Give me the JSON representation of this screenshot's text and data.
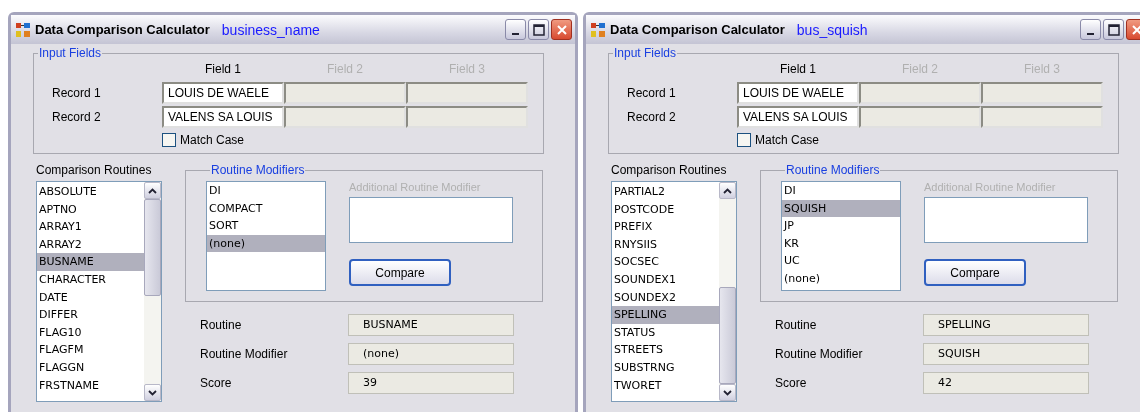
{
  "windows": [
    {
      "title": "Data Comparison Calculator",
      "subtitle": "business_name",
      "input_fields": {
        "title": "Input Fields",
        "columns": [
          {
            "label": "Field 1",
            "disabled": false
          },
          {
            "label": "Field 2",
            "disabled": true
          },
          {
            "label": "Field 3",
            "disabled": true
          }
        ],
        "records": [
          {
            "label": "Record 1",
            "value": "LOUIS DE WAELE"
          },
          {
            "label": "Record 2",
            "value": "VALENS SA LOUIS"
          }
        ],
        "match_case": {
          "label": "Match Case",
          "checked": false
        }
      },
      "routines": {
        "label": "Comparison Routines",
        "items": [
          {
            "label": "ABSOLUTE",
            "selected": false
          },
          {
            "label": "APTNO",
            "selected": false
          },
          {
            "label": "ARRAY1",
            "selected": false
          },
          {
            "label": "ARRAY2",
            "selected": false
          },
          {
            "label": "BUSNAME",
            "selected": true
          },
          {
            "label": "CHARACTER",
            "selected": false
          },
          {
            "label": "DATE",
            "selected": false
          },
          {
            "label": "DIFFER",
            "selected": false
          },
          {
            "label": "FLAG10",
            "selected": false
          },
          {
            "label": "FLAGFM",
            "selected": false
          },
          {
            "label": "FLAGGN",
            "selected": false
          },
          {
            "label": "FRSTNAME",
            "selected": false
          }
        ]
      },
      "modifiers": {
        "title": "Routine Modifiers",
        "items": [
          {
            "label": "DI",
            "selected": false
          },
          {
            "label": "COMPACT",
            "selected": false
          },
          {
            "label": "SORT",
            "selected": false
          },
          {
            "label": "(none)",
            "selected": true
          }
        ],
        "additional": {
          "label": "Additional Routine Modifier",
          "disabled": true
        },
        "button": "Compare"
      },
      "results": [
        {
          "label": "Routine",
          "value": "BUSNAME"
        },
        {
          "label": "Routine Modifier",
          "value": "(none)"
        },
        {
          "label": "Score",
          "value": "39"
        }
      ]
    },
    {
      "title": "Data Comparison Calculator",
      "subtitle": "bus_squish",
      "input_fields": {
        "title": "Input Fields",
        "columns": [
          {
            "label": "Field 1",
            "disabled": false
          },
          {
            "label": "Field 2",
            "disabled": true
          },
          {
            "label": "Field 3",
            "disabled": true
          }
        ],
        "records": [
          {
            "label": "Record 1",
            "value": "LOUIS DE WAELE"
          },
          {
            "label": "Record 2",
            "value": "VALENS SA LOUIS"
          }
        ],
        "match_case": {
          "label": "Match Case",
          "checked": false
        }
      },
      "routines": {
        "label": "Comparison Routines",
        "items": [
          {
            "label": "PARTIAL2",
            "selected": false
          },
          {
            "label": "POSTCODE",
            "selected": false
          },
          {
            "label": "PREFIX",
            "selected": false
          },
          {
            "label": "RNYSIIS",
            "selected": false
          },
          {
            "label": "SOCSEC",
            "selected": false
          },
          {
            "label": "SOUNDEX1",
            "selected": false
          },
          {
            "label": "SOUNDEX2",
            "selected": false
          },
          {
            "label": "SPELLING",
            "selected": true
          },
          {
            "label": "STATUS",
            "selected": false
          },
          {
            "label": "STREETS",
            "selected": false
          },
          {
            "label": "SUBSTRNG",
            "selected": false
          },
          {
            "label": "TWORET",
            "selected": false
          }
        ]
      },
      "modifiers": {
        "title": "Routine Modifiers",
        "items": [
          {
            "label": "DI",
            "selected": false
          },
          {
            "label": "SQUISH",
            "selected": true
          },
          {
            "label": "JP",
            "selected": false
          },
          {
            "label": "KR",
            "selected": false
          },
          {
            "label": "UC",
            "selected": false
          },
          {
            "label": "(none)",
            "selected": false
          }
        ],
        "additional": {
          "label": "Additional Routine Modifier",
          "disabled": true
        },
        "button": "Compare"
      },
      "results": [
        {
          "label": "Routine",
          "value": "SPELLING"
        },
        {
          "label": "Routine Modifier",
          "value": "SQUISH"
        },
        {
          "label": "Score",
          "value": "42"
        }
      ]
    }
  ]
}
